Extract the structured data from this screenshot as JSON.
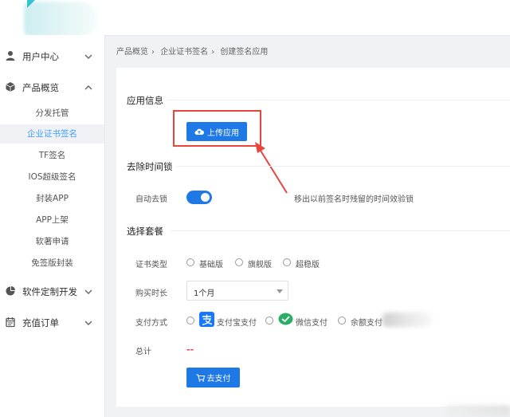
{
  "sidebar": {
    "items": [
      {
        "label": "用户中心",
        "icon": "user-icon"
      },
      {
        "label": "产品概览",
        "icon": "cube-icon"
      },
      {
        "label": "软件定制开发",
        "icon": "pie-icon"
      },
      {
        "label": "充值订单",
        "icon": "calendar-icon"
      }
    ],
    "sub_items": [
      "分发托管",
      "企业证书签名",
      "TF签名",
      "IOS超级签名",
      "封装APP",
      "APP上架",
      "软著申请",
      "免签版封装"
    ],
    "active_sub": "企业证书签名"
  },
  "breadcrumb": [
    "产品概览",
    "企业证书签名",
    "创建签名应用"
  ],
  "sections": {
    "app_info": "应用信息",
    "remove_time_lock": "去除时间锁",
    "choose_package": "选择套餐"
  },
  "upload_button": "上传应用",
  "auto_unlock": {
    "label": "自动去锁",
    "enabled": true,
    "hint": "移出以前签名时残留的时间效验锁"
  },
  "cert_type": {
    "label": "证书类型",
    "options": [
      "基础版",
      "旗舰版",
      "超稳版"
    ]
  },
  "duration": {
    "label": "购买时长",
    "value": "1个月"
  },
  "payment": {
    "label": "支付方式",
    "options": [
      "支付宝支付",
      "微信支付",
      "余额支付"
    ]
  },
  "total": {
    "label": "总计",
    "value": "--"
  },
  "pay_button": "去支付",
  "colors": {
    "primary": "#1e78e6",
    "annotation": "#e8453c",
    "alipay": "#1677ff",
    "wechat": "#2aae67"
  }
}
